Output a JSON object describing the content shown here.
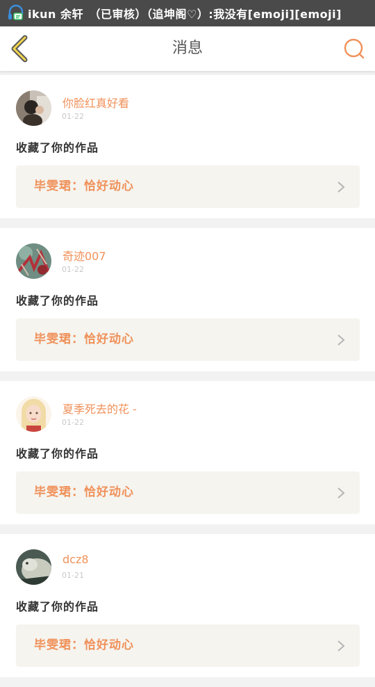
{
  "status_bar": {
    "text": "ikun 余轩　（已审核）（追坤阁♡）:我没有[emoji][emoji]",
    "notification_icon": "headphone-chat-icon"
  },
  "header": {
    "title": "消息",
    "back_icon": "chevron-left-icon",
    "search_icon": "search-icon",
    "accent_color": "#f0915a"
  },
  "messages": [
    {
      "username": "你脸红真好看",
      "date": "01-22",
      "action": "收藏了你的作品",
      "work_title": "毕雯珺：恰好动心"
    },
    {
      "username": "奇迹007",
      "date": "01-22",
      "action": "收藏了你的作品",
      "work_title": "毕雯珺：恰好动心"
    },
    {
      "username": "夏季死去的花 -",
      "date": "01-22",
      "action": "收藏了你的作品",
      "work_title": "毕雯珺：恰好动心"
    },
    {
      "username": "dcz8",
      "date": "01-21",
      "action": "收藏了你的作品",
      "work_title": "毕雯珺：恰好动心"
    }
  ]
}
